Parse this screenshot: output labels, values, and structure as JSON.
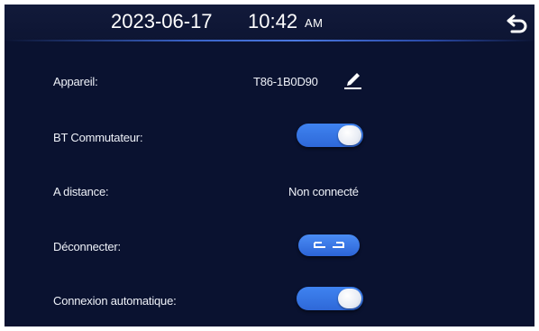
{
  "header": {
    "date": "2023-06-17",
    "time": "10:42",
    "ampm": "AM",
    "back_icon": "back-arrow-icon"
  },
  "settings": {
    "device": {
      "label": "Appareil:",
      "value": "T86-1B0D90",
      "edit_icon": "pencil-icon"
    },
    "bt_switch": {
      "label": "BT Commutateur:",
      "state": "on"
    },
    "remote": {
      "label": "A distance:",
      "value": "Non connecté"
    },
    "disconnect": {
      "label": "Déconnecter:",
      "icon": "disconnect-icon"
    },
    "auto_connect": {
      "label": "Connexion automatique:",
      "state": "on"
    }
  },
  "colors": {
    "background": "#0a1230",
    "accent": "#3a78e8",
    "text": "#eef1f8"
  }
}
